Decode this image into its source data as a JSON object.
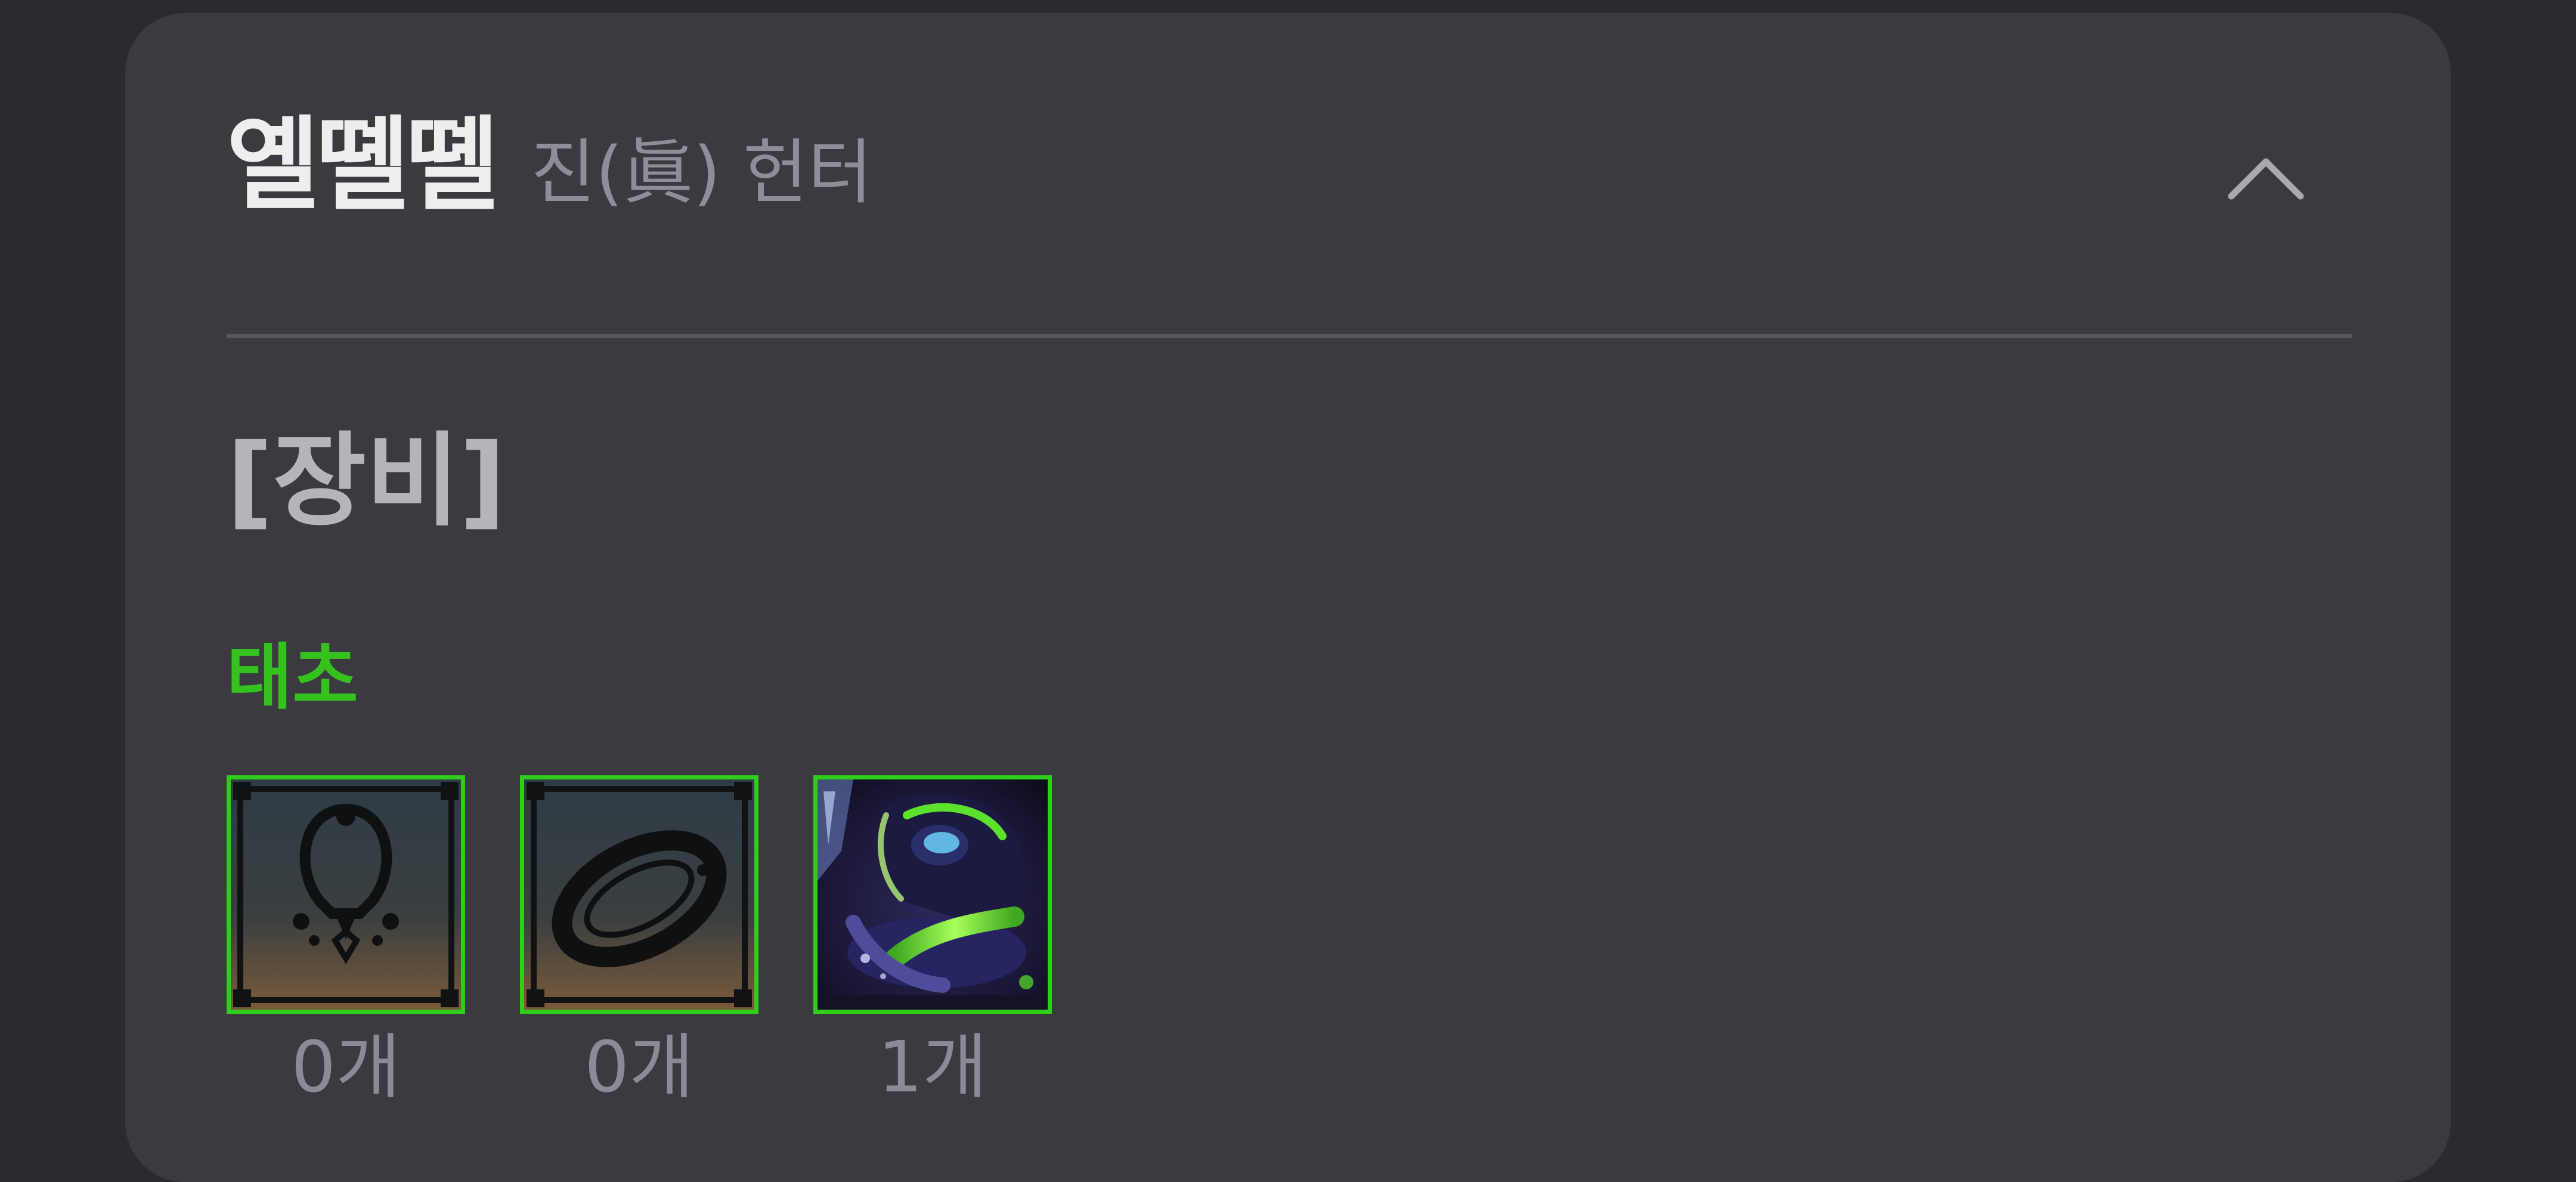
{
  "header": {
    "character_name": "옐뗼뗼",
    "character_class": "진(眞) 헌터",
    "collapse_icon": "chevron-up-icon"
  },
  "section": {
    "title": "[장비]"
  },
  "group": {
    "label": "태초",
    "label_color": "#35c21f",
    "border_color": "#2fce1a",
    "items": [
      {
        "icon": "necklace-icon",
        "count": "0개"
      },
      {
        "icon": "bracelet-icon",
        "count": "0개"
      },
      {
        "icon": "ring-icon",
        "count": "1개"
      }
    ]
  },
  "colors": {
    "background": "#2b2b2f",
    "card": "#3a3a40",
    "divider": "#56565d"
  }
}
